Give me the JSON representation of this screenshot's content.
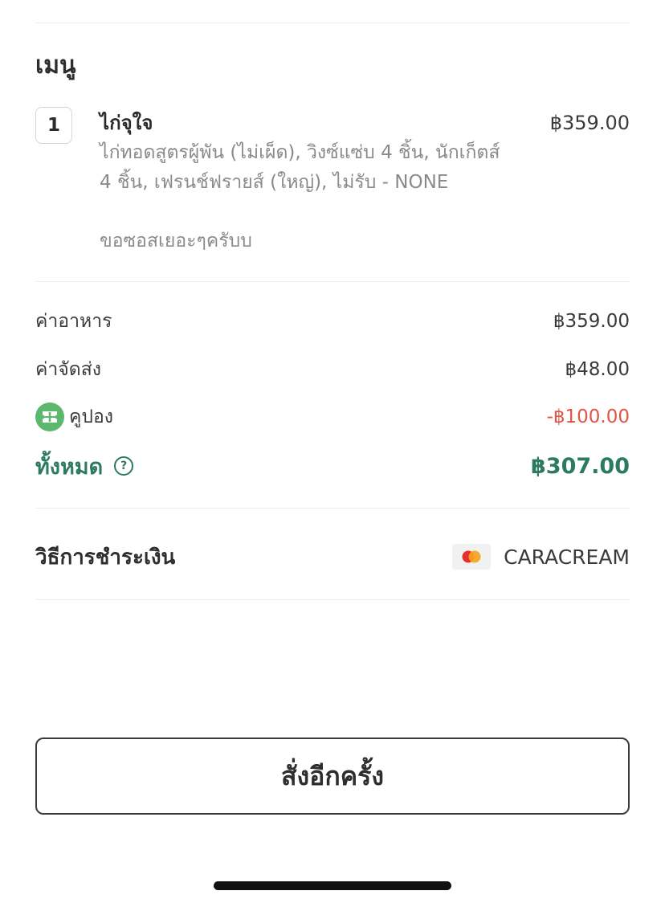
{
  "menu": {
    "title": "เมนู",
    "item": {
      "quantity": "1",
      "name": "ไก่จุใจ",
      "price": "฿359.00",
      "description": "ไก่ทอดสูตรผู้พัน (ไม่เผ็ด), วิงซ์แซ่บ 4 ชิ้น, นักเก็ตส์ 4 ชิ้น, เฟรนช์ฟรายส์ (ใหญ่), ไม่รับ - NONE",
      "note": "ขอซอสเยอะๆครับบ"
    }
  },
  "summary": {
    "food_label": "ค่าอาหาร",
    "food_value": "฿359.00",
    "delivery_label": "ค่าจัดส่ง",
    "delivery_value": "฿48.00",
    "coupon_label": "คูปอง",
    "coupon_value": "-฿100.00",
    "total_label": "ทั้งหมด",
    "total_value": "฿307.00",
    "help_glyph": "?"
  },
  "payment": {
    "label": "วิธีการชำระเงิน",
    "method": "CARACREAM",
    "card_icon": "mastercard-icon"
  },
  "actions": {
    "reorder_label": "สั่งอีกครั้ง"
  },
  "colors": {
    "accent_green": "#2c7a62",
    "coupon_green": "#5bb86c",
    "discount_red": "#e05545",
    "secondary_text": "#8a8a8a"
  }
}
